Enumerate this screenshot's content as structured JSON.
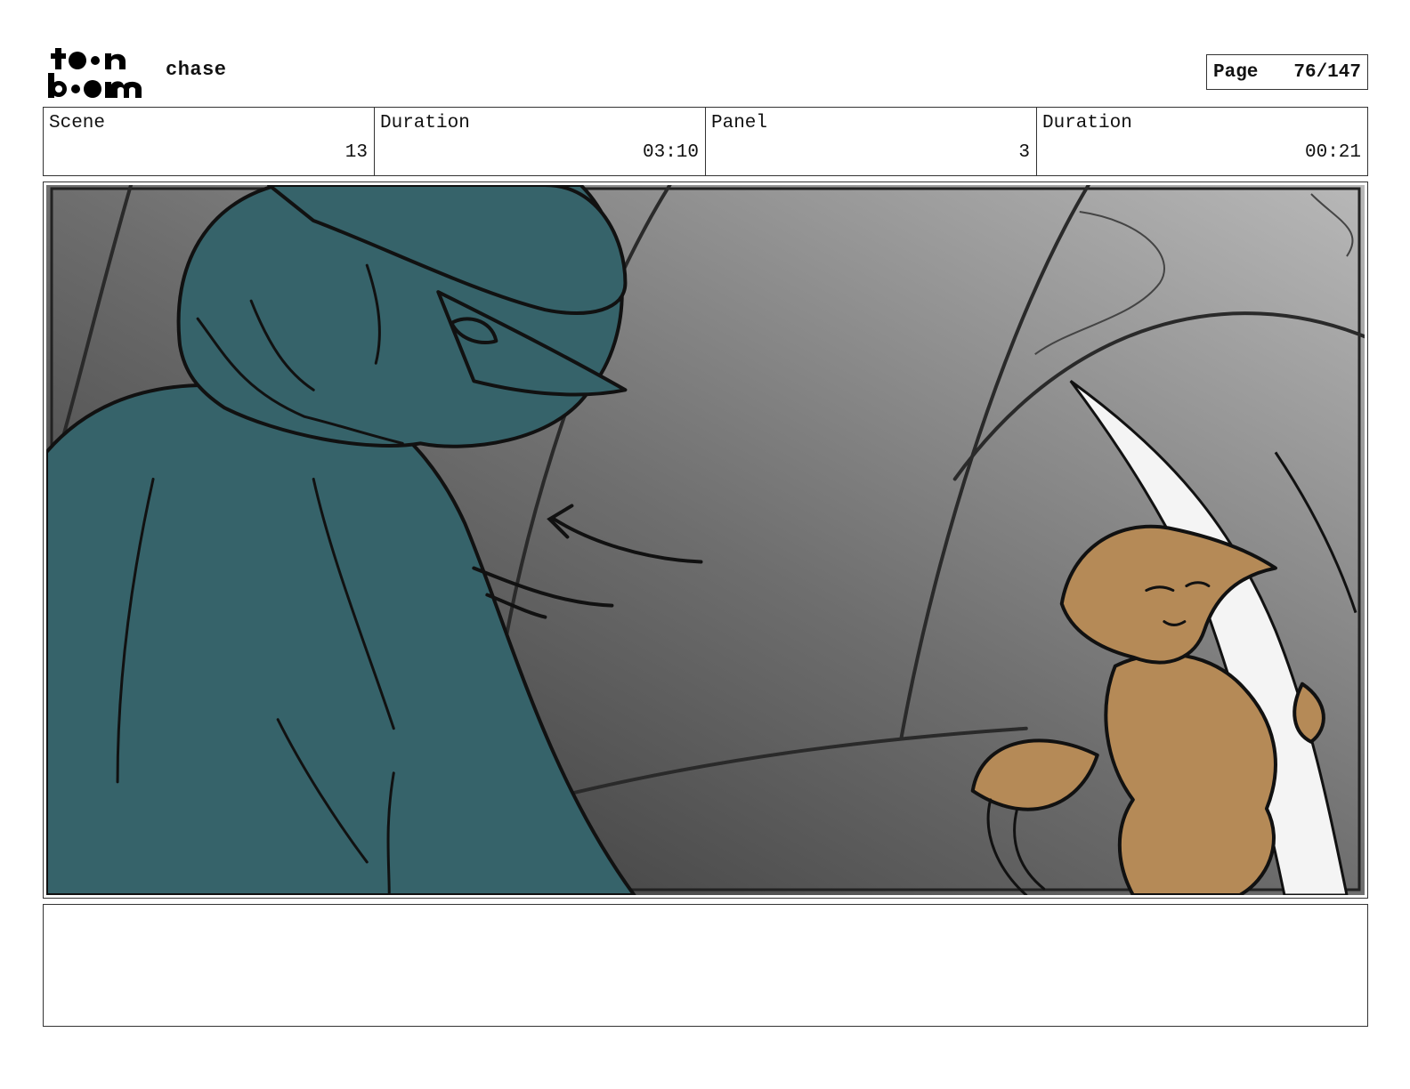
{
  "header": {
    "logo_top": "toon",
    "logo_bottom": "boom",
    "project_title": "chase",
    "page_label": "Page",
    "page_value": "76/147"
  },
  "info": {
    "scene_label": "Scene",
    "scene_value": "13",
    "scene_duration_label": "Duration",
    "scene_duration_value": "03:10",
    "panel_label": "Panel",
    "panel_value": "3",
    "panel_duration_label": "Duration",
    "panel_duration_value": "00:21"
  },
  "notes": {
    "text": ""
  },
  "colors": {
    "teal_character": "#36636a",
    "tan_character": "#b58a57",
    "background_dark": "#3a3a3a",
    "background_light": "#b4b4b4"
  }
}
